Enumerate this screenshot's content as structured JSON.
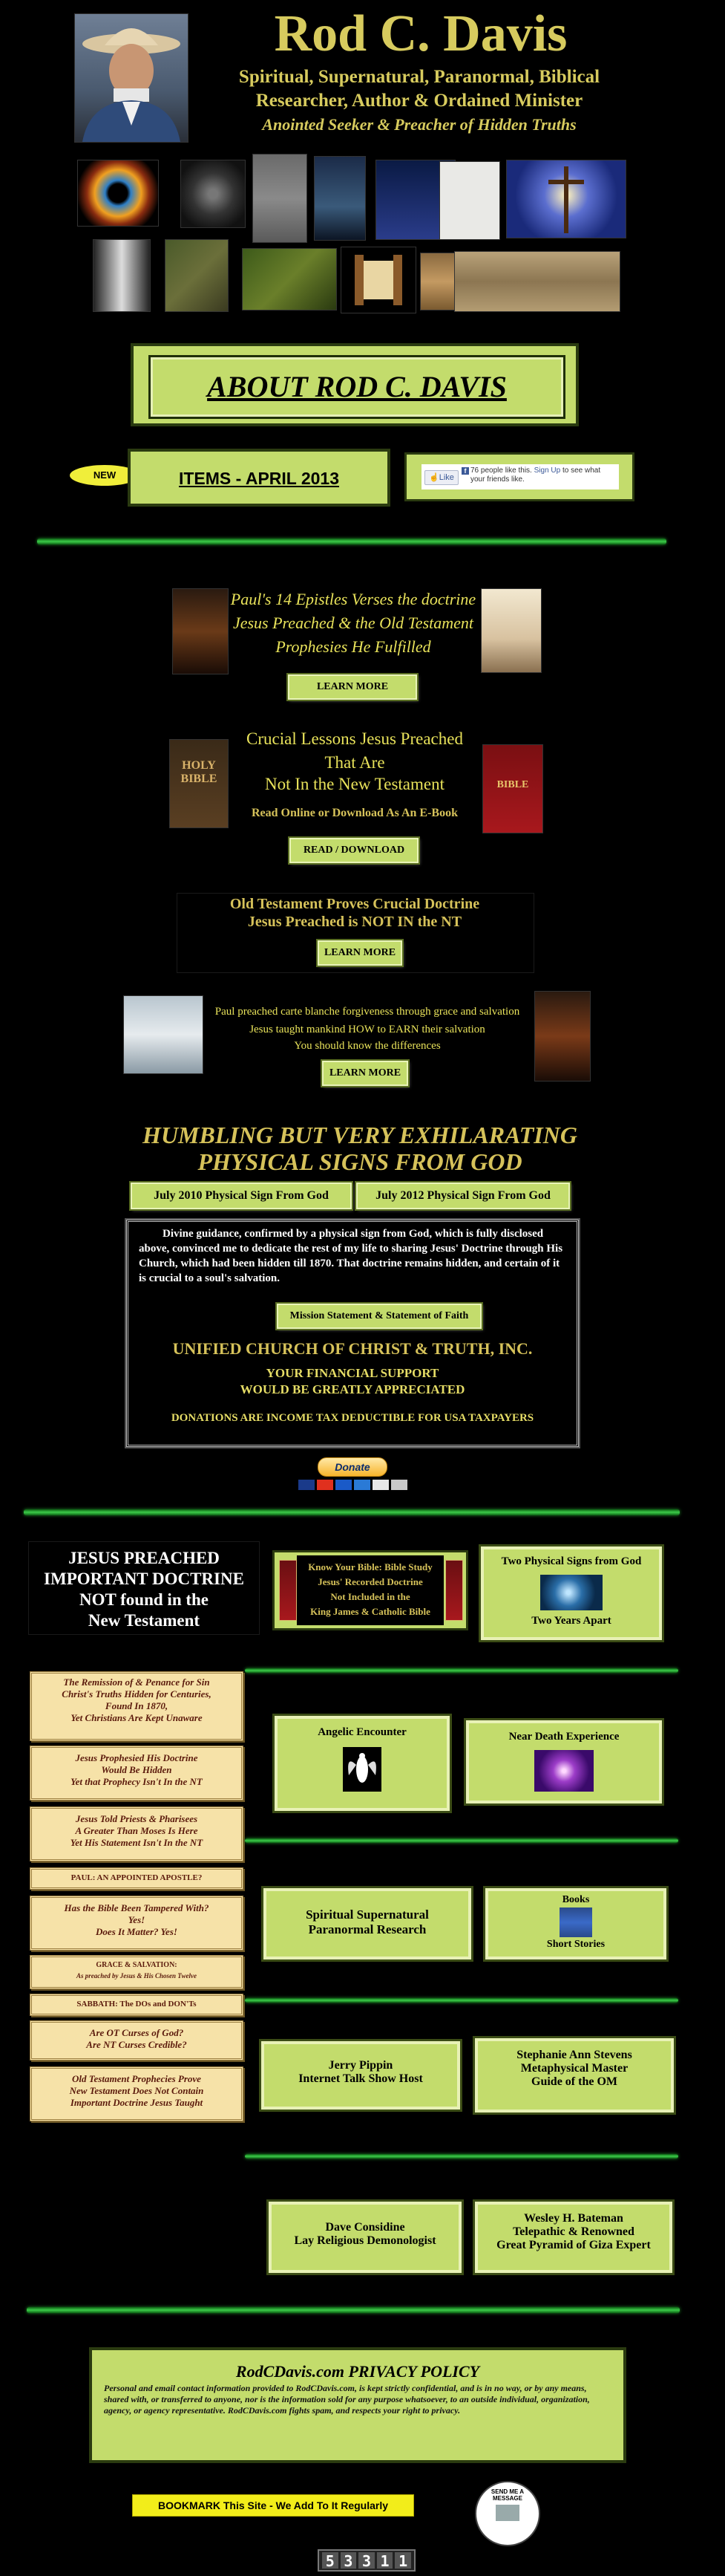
{
  "header": {
    "name": "Rod C. Davis",
    "subtitle_line1": "Spiritual, Supernatural, Paranormal, Biblical",
    "subtitle_line2": "Researcher, Author & Ordained Minister",
    "tagline": "Anointed Seeker & Preacher of Hidden Truths"
  },
  "about_banner": "ABOUT ROD C. DAVIS",
  "new_badge": "NEW",
  "items_link": "ITEMS - APRIL 2013",
  "facebook": {
    "like_label": "Like",
    "text_pre": "76 people like this.",
    "signup": "Sign Up",
    "text_post": "to see what your friends like."
  },
  "promo1": {
    "line1": "Paul's 14 Epistles Verses the doctrine",
    "line2": "Jesus Preached & the Old Testament",
    "line3": "Prophesies He Fulfilled",
    "button": "LEARN MORE"
  },
  "promo2": {
    "line1": "Crucial Lessons Jesus Preached",
    "line2": "That Are",
    "line3": "Not In the New Testament",
    "line4": "Read Online or Download As An E-Book",
    "button": "READ / DOWNLOAD",
    "book_left": "HOLY BIBLE",
    "book_right": "BIBLE"
  },
  "promo3": {
    "line1": "Old Testament Proves Crucial Doctrine",
    "line2": "Jesus Preached is NOT IN the NT",
    "button": "LEARN MORE"
  },
  "promo4": {
    "line1": "Paul preached carte blanche forgiveness through grace and salvation",
    "line2": "Jesus taught mankind HOW to EARN their salvation",
    "line3": "You should know the differences",
    "button": "LEARN MORE"
  },
  "signs": {
    "title_line1": "HUMBLING BUT VERY EXHILARATING",
    "title_line2": "PHYSICAL SIGNS FROM GOD",
    "btn1": "July 2010 Physical Sign From God",
    "btn2": "July 2012 Physical Sign From God"
  },
  "mission": {
    "paragraph": "Divine guidance, confirmed by a physical sign from God, which is fully disclosed above, convinced me to dedicate the rest of my life to sharing Jesus' Doctrine through His Church, which had been hidden till 1870. That doctrine remains hidden, and certain of it is crucial to a soul's salvation.",
    "button": "Mission Statement & Statement of Faith",
    "church": "UNIFIED CHURCH OF CHRIST & TRUTH, INC.",
    "support1": "YOUR FINANCIAL SUPPORT",
    "support2": "WOULD BE GREATLY APPRECIATED",
    "deductible": "DONATIONS ARE INCOME TAX DEDUCTIBLE FOR USA TAXPAYERS",
    "donate": "Donate"
  },
  "doctrine_box": {
    "line1": "JESUS PREACHED",
    "line2": "IMPORTANT DOCTRINE",
    "line3": "NOT found in the",
    "line4": "New Testament"
  },
  "kyb": {
    "line1": "Know Your Bible: Bible Study",
    "line2": "Jesus' Recorded Doctrine",
    "line3": "Not Included in the",
    "line4": "King James & Catholic Bible"
  },
  "two_signs": {
    "title": "Two Physical Signs from God",
    "caption": "Two Years Apart"
  },
  "left_links": [
    [
      "The Remission of & Penance for Sin",
      "Christ's Truths Hidden for Centuries,",
      "Found In 1870,",
      "Yet Christians Are Kept Unaware"
    ],
    [
      "Jesus Prophesied  His Doctrine",
      "Would Be Hidden",
      "Yet that Prophecy Isn't In the NT"
    ],
    [
      "Jesus Told Priests & Pharisees",
      "A Greater Than Moses Is Here",
      "Yet His Statement Isn't In the NT"
    ],
    [
      "PAUL: AN APPOINTED APOSTLE?"
    ],
    [
      "Has the Bible Been Tampered With?",
      "Yes!",
      "Does It Matter? Yes!"
    ],
    [
      "GRACE & SALVATION:",
      "As preached by Jesus & His Chosen Twelve"
    ],
    [
      "SABBATH: The DOs and DON'Ts"
    ],
    [
      "Are OT Curses of God?",
      "Are NT Curses Credible?"
    ],
    [
      "Old Testament Prophecies Prove",
      "New Testament Does Not Contain",
      "Important Doctrine Jesus Taught"
    ]
  ],
  "tiles": {
    "angelic": "Angelic Encounter",
    "nde": "Near Death Experience",
    "ssr1": "Spiritual Supernatural",
    "ssr2": "Paranormal Research",
    "books": "Books",
    "short": "Short Stories",
    "jerry1": "Jerry Pippin",
    "jerry2": "Internet Talk Show Host",
    "steph1": "Stephanie Ann Stevens",
    "steph2": "Metaphysical Master",
    "steph3": "Guide of the OM",
    "dave1": "Dave Considine",
    "dave2": "Lay Religious Demonologist",
    "wes1": "Wesley H. Bateman",
    "wes2": "Telepathic & Renowned",
    "wes3": "Great Pyramid of Giza Expert"
  },
  "privacy": {
    "title": "RodCDavis.com PRIVACY POLICY",
    "body": "Personal and email contact information provided to RodCDavis.com, is kept strictly confidential, and is in no way, or by any means, shared with, or transferred to anyone, nor is the information sold for any purpose whatsoever, to an outside individual, organization, agency, or agency representative. RodCDavis.com fights spam, and respects your right to privacy."
  },
  "bookmark": "BOOKMARK This Site - We Add To It Regularly",
  "send_message": "SEND ME A MESSAGE",
  "counter": [
    "5",
    "3",
    "3",
    "1",
    "1"
  ],
  "colors": {
    "lime": "#c3dc6c",
    "gold": "#d6c25a",
    "green_rule": "#3ccc4a",
    "parchment": "#f6e2a8"
  }
}
